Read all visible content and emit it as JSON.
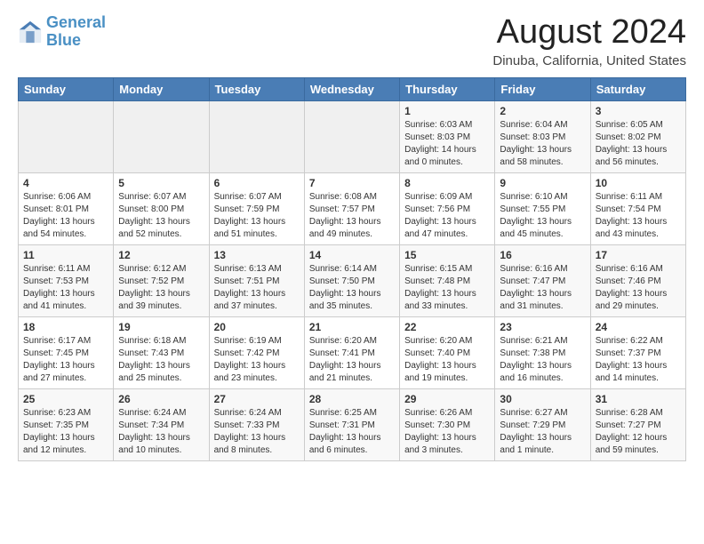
{
  "header": {
    "logo_line1": "General",
    "logo_line2": "Blue",
    "month_year": "August 2024",
    "location": "Dinuba, California, United States"
  },
  "weekdays": [
    "Sunday",
    "Monday",
    "Tuesday",
    "Wednesday",
    "Thursday",
    "Friday",
    "Saturday"
  ],
  "weeks": [
    [
      {
        "day": "",
        "info": ""
      },
      {
        "day": "",
        "info": ""
      },
      {
        "day": "",
        "info": ""
      },
      {
        "day": "",
        "info": ""
      },
      {
        "day": "1",
        "info": "Sunrise: 6:03 AM\nSunset: 8:03 PM\nDaylight: 14 hours\nand 0 minutes."
      },
      {
        "day": "2",
        "info": "Sunrise: 6:04 AM\nSunset: 8:03 PM\nDaylight: 13 hours\nand 58 minutes."
      },
      {
        "day": "3",
        "info": "Sunrise: 6:05 AM\nSunset: 8:02 PM\nDaylight: 13 hours\nand 56 minutes."
      }
    ],
    [
      {
        "day": "4",
        "info": "Sunrise: 6:06 AM\nSunset: 8:01 PM\nDaylight: 13 hours\nand 54 minutes."
      },
      {
        "day": "5",
        "info": "Sunrise: 6:07 AM\nSunset: 8:00 PM\nDaylight: 13 hours\nand 52 minutes."
      },
      {
        "day": "6",
        "info": "Sunrise: 6:07 AM\nSunset: 7:59 PM\nDaylight: 13 hours\nand 51 minutes."
      },
      {
        "day": "7",
        "info": "Sunrise: 6:08 AM\nSunset: 7:57 PM\nDaylight: 13 hours\nand 49 minutes."
      },
      {
        "day": "8",
        "info": "Sunrise: 6:09 AM\nSunset: 7:56 PM\nDaylight: 13 hours\nand 47 minutes."
      },
      {
        "day": "9",
        "info": "Sunrise: 6:10 AM\nSunset: 7:55 PM\nDaylight: 13 hours\nand 45 minutes."
      },
      {
        "day": "10",
        "info": "Sunrise: 6:11 AM\nSunset: 7:54 PM\nDaylight: 13 hours\nand 43 minutes."
      }
    ],
    [
      {
        "day": "11",
        "info": "Sunrise: 6:11 AM\nSunset: 7:53 PM\nDaylight: 13 hours\nand 41 minutes."
      },
      {
        "day": "12",
        "info": "Sunrise: 6:12 AM\nSunset: 7:52 PM\nDaylight: 13 hours\nand 39 minutes."
      },
      {
        "day": "13",
        "info": "Sunrise: 6:13 AM\nSunset: 7:51 PM\nDaylight: 13 hours\nand 37 minutes."
      },
      {
        "day": "14",
        "info": "Sunrise: 6:14 AM\nSunset: 7:50 PM\nDaylight: 13 hours\nand 35 minutes."
      },
      {
        "day": "15",
        "info": "Sunrise: 6:15 AM\nSunset: 7:48 PM\nDaylight: 13 hours\nand 33 minutes."
      },
      {
        "day": "16",
        "info": "Sunrise: 6:16 AM\nSunset: 7:47 PM\nDaylight: 13 hours\nand 31 minutes."
      },
      {
        "day": "17",
        "info": "Sunrise: 6:16 AM\nSunset: 7:46 PM\nDaylight: 13 hours\nand 29 minutes."
      }
    ],
    [
      {
        "day": "18",
        "info": "Sunrise: 6:17 AM\nSunset: 7:45 PM\nDaylight: 13 hours\nand 27 minutes."
      },
      {
        "day": "19",
        "info": "Sunrise: 6:18 AM\nSunset: 7:43 PM\nDaylight: 13 hours\nand 25 minutes."
      },
      {
        "day": "20",
        "info": "Sunrise: 6:19 AM\nSunset: 7:42 PM\nDaylight: 13 hours\nand 23 minutes."
      },
      {
        "day": "21",
        "info": "Sunrise: 6:20 AM\nSunset: 7:41 PM\nDaylight: 13 hours\nand 21 minutes."
      },
      {
        "day": "22",
        "info": "Sunrise: 6:20 AM\nSunset: 7:40 PM\nDaylight: 13 hours\nand 19 minutes."
      },
      {
        "day": "23",
        "info": "Sunrise: 6:21 AM\nSunset: 7:38 PM\nDaylight: 13 hours\nand 16 minutes."
      },
      {
        "day": "24",
        "info": "Sunrise: 6:22 AM\nSunset: 7:37 PM\nDaylight: 13 hours\nand 14 minutes."
      }
    ],
    [
      {
        "day": "25",
        "info": "Sunrise: 6:23 AM\nSunset: 7:35 PM\nDaylight: 13 hours\nand 12 minutes."
      },
      {
        "day": "26",
        "info": "Sunrise: 6:24 AM\nSunset: 7:34 PM\nDaylight: 13 hours\nand 10 minutes."
      },
      {
        "day": "27",
        "info": "Sunrise: 6:24 AM\nSunset: 7:33 PM\nDaylight: 13 hours\nand 8 minutes."
      },
      {
        "day": "28",
        "info": "Sunrise: 6:25 AM\nSunset: 7:31 PM\nDaylight: 13 hours\nand 6 minutes."
      },
      {
        "day": "29",
        "info": "Sunrise: 6:26 AM\nSunset: 7:30 PM\nDaylight: 13 hours\nand 3 minutes."
      },
      {
        "day": "30",
        "info": "Sunrise: 6:27 AM\nSunset: 7:29 PM\nDaylight: 13 hours\nand 1 minute."
      },
      {
        "day": "31",
        "info": "Sunrise: 6:28 AM\nSunset: 7:27 PM\nDaylight: 12 hours\nand 59 minutes."
      }
    ]
  ]
}
